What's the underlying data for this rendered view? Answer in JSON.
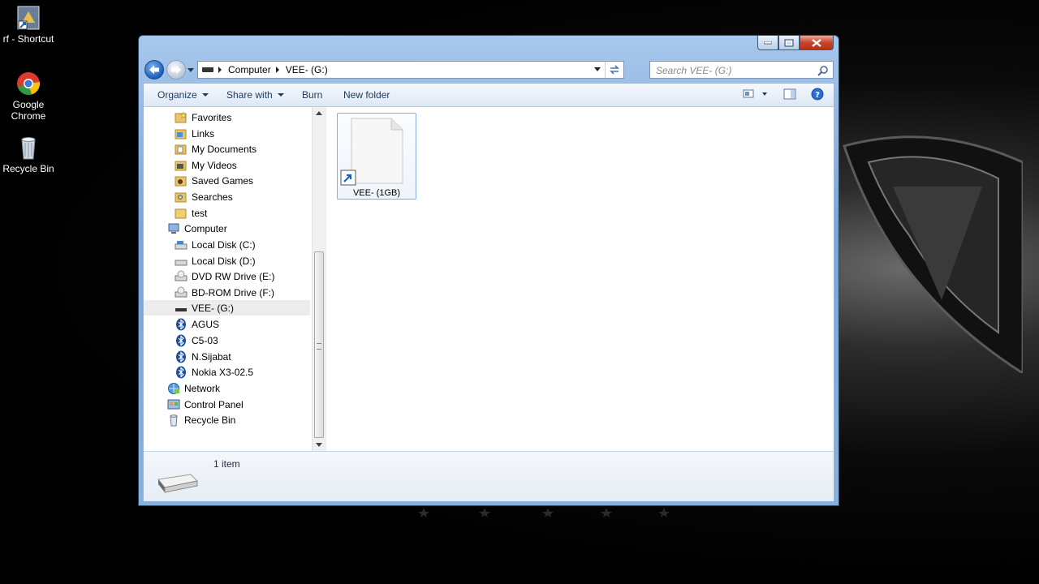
{
  "desktop": {
    "icons": [
      {
        "label": "rf - Shortcut"
      },
      {
        "label": "Google Chrome"
      },
      {
        "label": "Recycle Bin"
      }
    ]
  },
  "window": {
    "address": {
      "crumbs": [
        "Computer",
        "VEE- (G:)"
      ]
    },
    "search": {
      "placeholder": "Search VEE- (G:)"
    },
    "toolbar": {
      "organize": "Organize",
      "share_with": "Share with",
      "burn": "Burn",
      "new_folder": "New folder"
    },
    "nav": {
      "items": [
        {
          "label": "Favorites",
          "icon": "favorites-folder-icon"
        },
        {
          "label": "Links",
          "icon": "links-folder-icon"
        },
        {
          "label": "My Documents",
          "icon": "documents-folder-icon"
        },
        {
          "label": "My Videos",
          "icon": "videos-folder-icon"
        },
        {
          "label": "Saved Games",
          "icon": "saved-games-folder-icon"
        },
        {
          "label": "Searches",
          "icon": "searches-folder-icon"
        },
        {
          "label": "test",
          "icon": "folder-icon"
        },
        {
          "label": "Computer",
          "icon": "computer-icon"
        },
        {
          "label": "Local Disk (C:)",
          "icon": "local-disk-icon"
        },
        {
          "label": "Local Disk (D:)",
          "icon": "local-disk-icon"
        },
        {
          "label": "DVD RW Drive (E:)",
          "icon": "dvd-drive-icon"
        },
        {
          "label": "BD-ROM Drive (F:)",
          "icon": "bd-drive-icon"
        },
        {
          "label": "VEE- (G:)",
          "icon": "removable-drive-icon"
        },
        {
          "label": "AGUS",
          "icon": "bluetooth-icon"
        },
        {
          "label": "C5-03",
          "icon": "bluetooth-icon"
        },
        {
          "label": "N.Sijabat",
          "icon": "bluetooth-icon"
        },
        {
          "label": "Nokia X3-02.5",
          "icon": "bluetooth-icon"
        },
        {
          "label": "Network",
          "icon": "network-icon"
        },
        {
          "label": "Control Panel",
          "icon": "control-panel-icon"
        },
        {
          "label": "Recycle Bin",
          "icon": "recycle-bin-icon"
        }
      ],
      "selected": "VEE- (G:)"
    },
    "files": [
      {
        "name": "VEE- (1GB)",
        "type": "shortcut"
      }
    ],
    "details": {
      "count": "1 item"
    }
  }
}
